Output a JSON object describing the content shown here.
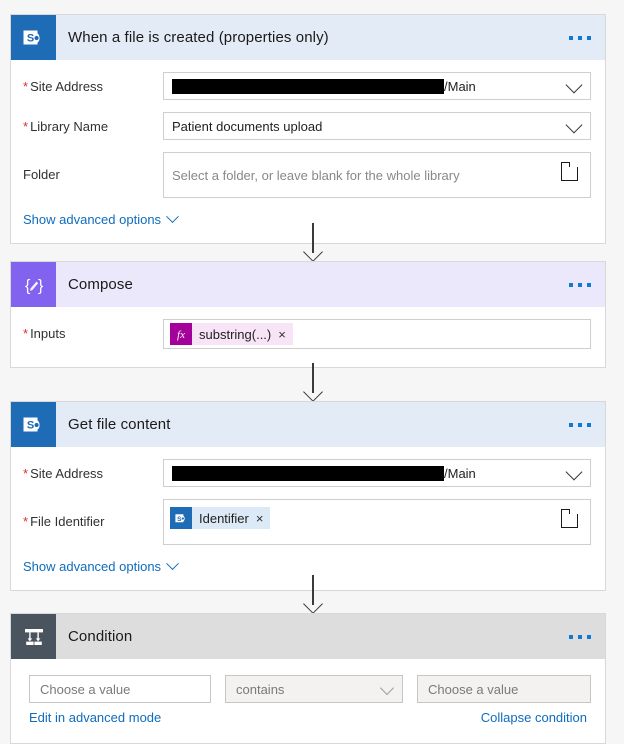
{
  "flow": {
    "cards": [
      {
        "id": "trigger",
        "title": "When a file is created (properties only)",
        "icon": "sharepoint-icon",
        "menu": "more-options",
        "fields": [
          {
            "label": "Site Address",
            "required": true,
            "type": "redacted-dropdown",
            "value_suffix": "/Main"
          },
          {
            "label": "Library Name",
            "required": true,
            "type": "dropdown",
            "value": "Patient documents upload"
          },
          {
            "label": "Folder",
            "required": false,
            "type": "folder-picker",
            "placeholder": "Select a folder, or leave blank for the whole library"
          }
        ],
        "advanced_link": "Show advanced options"
      },
      {
        "id": "compose",
        "title": "Compose",
        "icon": "compose-icon",
        "menu": "more-options",
        "fields": [
          {
            "label": "Inputs",
            "required": true,
            "type": "token-field",
            "token": {
              "badge": "fx",
              "text": "substring(...)",
              "remove": "×"
            }
          }
        ]
      },
      {
        "id": "get-file-content",
        "title": "Get file content",
        "icon": "sharepoint-icon",
        "menu": "more-options",
        "fields": [
          {
            "label": "Site Address",
            "required": true,
            "type": "redacted-dropdown",
            "value_suffix": "/Main"
          },
          {
            "label": "File Identifier",
            "required": true,
            "type": "token-folder-field",
            "token": {
              "badge": "sharepoint",
              "text": "Identifier",
              "remove": "×"
            }
          }
        ],
        "advanced_link": "Show advanced options"
      },
      {
        "id": "condition",
        "title": "Condition",
        "icon": "condition-icon",
        "menu": "more-options",
        "condition": {
          "left_placeholder": "Choose a value",
          "operator": "contains",
          "right_placeholder": "Choose a value",
          "advanced_link": "Edit in advanced mode",
          "collapse_link": "Collapse condition"
        }
      }
    ]
  },
  "colors": {
    "sharepoint_blue": "#1e6cb5",
    "compose_purple": "#8163ef",
    "condition_gray": "#4a545e",
    "link_blue": "#0f6cbd",
    "required_red": "#d93025",
    "fx_magenta": "#a4019b"
  }
}
